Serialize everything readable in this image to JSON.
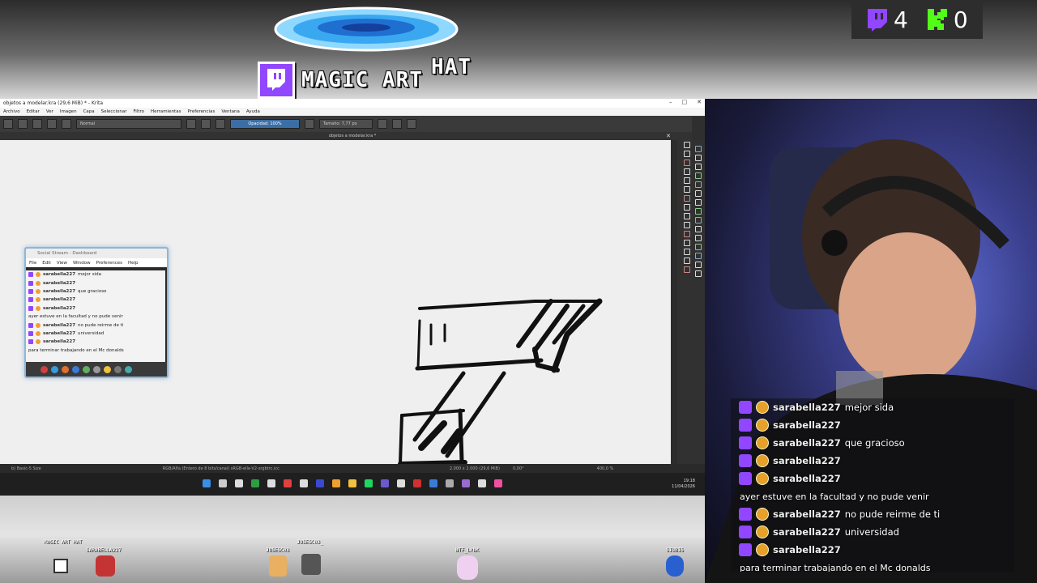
{
  "overlay": {
    "title_main": "MAGIC ART",
    "title_hat": "HAT",
    "counters": [
      {
        "platform": "twitch",
        "value": "4",
        "color": "#9146ff"
      },
      {
        "platform": "kick",
        "value": "0",
        "color": "#53fc18"
      }
    ]
  },
  "krita": {
    "window_title": "objetos a modelar.kra (29,6 MiB) * - Krita",
    "menu": [
      "Archivo",
      "Editar",
      "Ver",
      "Imagen",
      "Capa",
      "Seleccionar",
      "Filtro",
      "Herramientas",
      "Preferencias",
      "Ventana",
      "Ayuda"
    ],
    "blend_mode": "Normal",
    "opacity": "Opacidad: 100%",
    "size": "Tamaño: 7,77 px",
    "doc_tab": "objetos a modelar.kra *",
    "status_brush": "b) Basic-5 Size",
    "status_color": "RGB/Alfa (Entero de 8 bits/canal)  sRGB-elle-V2-srgbtrc.icc",
    "status_dims": "2.000 x 2.000 (29,6 MiB)",
    "status_angle": "0,00°",
    "status_zoom": "400,0 %",
    "clock_time": "19:18",
    "clock_date": "11/04/2026"
  },
  "social": {
    "title": "Social Stream - Dashboard",
    "menu": [
      "File",
      "Edit",
      "View",
      "Window",
      "Preferences",
      "Help"
    ],
    "rows": [
      {
        "user": "sarabella227",
        "text": "mejor sida"
      },
      {
        "user": "sarabella227",
        "text": ""
      },
      {
        "user": "sarabella227",
        "text": "que gracioso"
      },
      {
        "user": "sarabella227",
        "text": ""
      },
      {
        "user": "sarabella227",
        "text": ""
      },
      {
        "user": "",
        "text": "ayer estuve en la facultad y no pude venir"
      },
      {
        "user": "sarabella227",
        "text": "no pude reirme de ti"
      },
      {
        "user": "sarabella227",
        "text": "universidad"
      },
      {
        "user": "sarabella227",
        "text": ""
      },
      {
        "user": "",
        "text": "para terminar trabajando en el Mc donalds"
      }
    ]
  },
  "chat": {
    "rows": [
      {
        "user": "sarabella227",
        "text": "mejor sida"
      },
      {
        "user": "sarabella227",
        "text": ""
      },
      {
        "user": "sarabella227",
        "text": "que gracioso"
      },
      {
        "user": "sarabella227",
        "text": ""
      },
      {
        "user": "sarabella227",
        "text": ""
      },
      {
        "user": "",
        "text": "ayer estuve en la facultad y no pude venir"
      },
      {
        "user": "sarabella227",
        "text": "no pude reirme de ti"
      },
      {
        "user": "sarabella227",
        "text": "universidad"
      },
      {
        "user": "sarabella227",
        "text": ""
      },
      {
        "user": "",
        "text": "para terminar trabajando en el Mc donalds"
      }
    ]
  },
  "avatars": [
    {
      "name": "MAGIC ART HAT"
    },
    {
      "name": "SARABELLA227"
    },
    {
      "name": "JOSESC03"
    },
    {
      "name": "JOSESC03_"
    },
    {
      "name": "WTF_LYNK"
    },
    {
      "name": "SIUBIS"
    }
  ]
}
